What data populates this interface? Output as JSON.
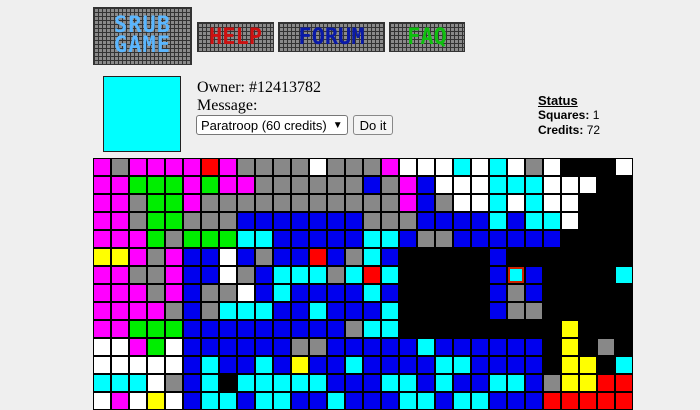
{
  "nav": {
    "logo_text": [
      "SRUB",
      "GAME"
    ],
    "buttons": [
      {
        "label": "HELP",
        "color": "#cc1111"
      },
      {
        "label": "FORUM",
        "color": "#0a1aa8"
      },
      {
        "label": "FAQ",
        "color": "#0fbf0f"
      }
    ]
  },
  "square": {
    "color": "#00ffff",
    "owner": "Owner: #12413782",
    "message_label": "Message:",
    "select_value": "Paratroop (60 credits)",
    "action_label": "Do it"
  },
  "status": {
    "title": "Status",
    "squares_label": "Squares:",
    "squares_value": "1",
    "credits_label": "Credits:",
    "credits_value": "72"
  },
  "board": {
    "palette": {
      "M": "#ff00ff",
      "G": "#888888",
      "L": "#00ee00",
      "R": "#ff0000",
      "W": "#ffffff",
      "B": "#0000ee",
      "C": "#00ffff",
      "Y": "#ffff00",
      "K": "#000000"
    },
    "selected": [
      6,
      23
    ],
    "rows": [
      "MGMMMMRMGGGGWGGGMWWWCWCWGWKKKW",
      "MMLLLMLMMGGGGGGBGMBWWWCCCWWWKK",
      "MMGLLMGGGGGGGGGGGMBGWWCWCWWKKK",
      "MMGLLGGGBBBBBBBGGGBBBBCBCCWKKK",
      "MMMLGLLLCCBBBBBCCBGGBBBBBBKKKK",
      "YYMGMBBWBGBBRBGCBKKKKKBKKKKKKK",
      "MMGGMBBWGBCCCGCRCKKKKKBCBKKKKC",
      "MMMGMBGGWBCBBBBCBKKKKKBGBKKKKK",
      "MMMMGBGCCCBBCBBBCKKKKKBGGKKKKK",
      "MMLLLBBBBBBBBBGCCKKKKKKKKKYKKK",
      "WWMLWBBBBBBGGBBBBBCBBBBBBKYKGK",
      "WWWWWBCBBCBYBBCBBBBCCBBBBKYYKC",
      "CCCWGBCKCCCCCBBBCCBCBBCCBGYYRR",
      "WMWYWBCCBCCBBCBBBCCBCCBBBRRRRR"
    ]
  }
}
